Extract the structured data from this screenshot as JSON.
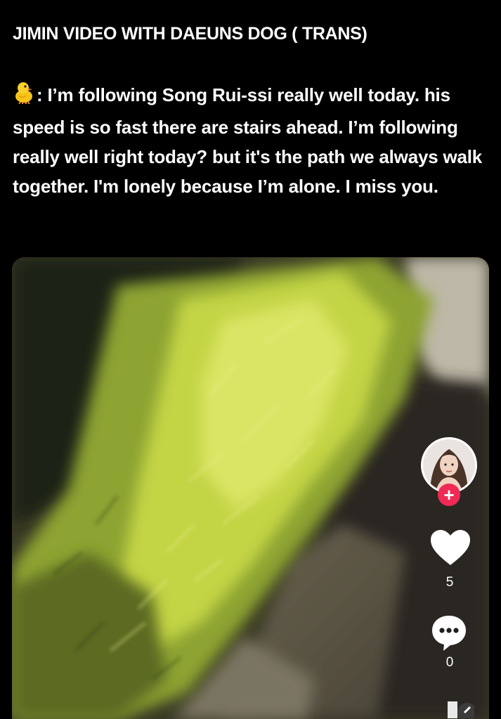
{
  "post": {
    "title": "JIMIN VIDEO WITH DAEUNS DOG ( TRANS)",
    "emoji_icon": "baby-chick-emoji",
    "body": ": I’m following Song Rui-ssi really well today. his speed is so fast there are stairs ahead. I’m following really well right today? but it's the path we always walk together. I'm lonely because I’m alone. I miss you."
  },
  "video": {
    "follow_label": "+",
    "like_count": "5",
    "comment_count": "0",
    "icons": {
      "like": "heart-icon",
      "comment": "comment-bubble-icon",
      "follow": "plus-icon"
    }
  },
  "colors": {
    "background": "#000000",
    "text": "#ffffff",
    "follow_accent": "#ee2a55"
  }
}
